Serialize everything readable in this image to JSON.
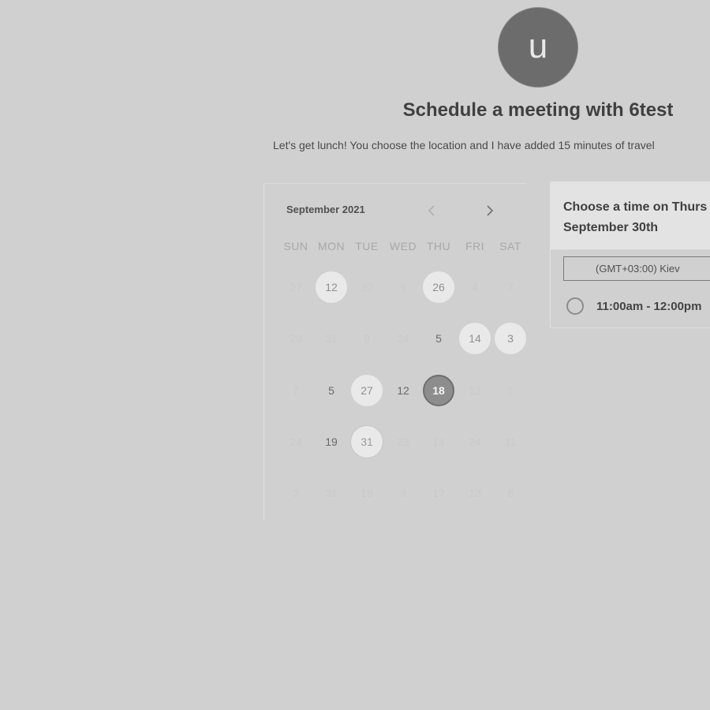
{
  "avatar": {
    "initial": "u"
  },
  "header": {
    "title": "Schedule a meeting with 6test",
    "description": "Let's get lunch! You choose the location and I have added 15 minutes of travel"
  },
  "calendar": {
    "month_label": "September 2021",
    "prev_icon": "chevron-left-icon",
    "next_icon": "chevron-right-icon",
    "weekdays": [
      "SUN",
      "MON",
      "TUE",
      "WED",
      "THU",
      "FRI",
      "SAT"
    ],
    "weeks": [
      [
        {
          "label": "27",
          "state": "faded"
        },
        {
          "label": "12",
          "state": "highlighted"
        },
        {
          "label": "30",
          "state": "faded"
        },
        {
          "label": "9",
          "state": "faded"
        },
        {
          "label": "26",
          "state": "highlighted"
        },
        {
          "label": "4",
          "state": "faded"
        },
        {
          "label": "7",
          "state": "faded"
        }
      ],
      [
        {
          "label": "20",
          "state": "faded"
        },
        {
          "label": "31",
          "state": "faded"
        },
        {
          "label": "9",
          "state": "faded"
        },
        {
          "label": "24",
          "state": "faded"
        },
        {
          "label": "5",
          "state": "available"
        },
        {
          "label": "14",
          "state": "highlighted"
        },
        {
          "label": "3",
          "state": "highlighted"
        }
      ],
      [
        {
          "label": "7",
          "state": "faded"
        },
        {
          "label": "5",
          "state": "available"
        },
        {
          "label": "27",
          "state": "highlighted"
        },
        {
          "label": "12",
          "state": "available"
        },
        {
          "label": "18",
          "state": "selected"
        },
        {
          "label": "13",
          "state": "faded"
        },
        {
          "label": "1",
          "state": "faded"
        }
      ],
      [
        {
          "label": "24",
          "state": "faded"
        },
        {
          "label": "19",
          "state": "available"
        },
        {
          "label": "31",
          "state": "noisy"
        },
        {
          "label": "23",
          "state": "faded"
        },
        {
          "label": "14",
          "state": "faded"
        },
        {
          "label": "24",
          "state": "faded"
        },
        {
          "label": "11",
          "state": "faded"
        }
      ],
      [
        {
          "label": "3",
          "state": "faded"
        },
        {
          "label": "31",
          "state": "faded"
        },
        {
          "label": "18",
          "state": "faded"
        },
        {
          "label": "9",
          "state": "faded"
        },
        {
          "label": "17",
          "state": "faded"
        },
        {
          "label": "13",
          "state": "faded"
        },
        {
          "label": "8",
          "state": "faded"
        }
      ]
    ]
  },
  "time_panel": {
    "heading_line1": "Choose a time on Thurs",
    "heading_line2": "September 30th",
    "timezone": "(GMT+03:00) Kiev",
    "slots": [
      {
        "label": "11:00am - 12:00pm"
      }
    ]
  },
  "colors": {
    "background": "#d0d0d0",
    "avatar": "#6c6c6c",
    "selected_day": "#8d8d8d",
    "highlight_day": "#e9e9e9"
  }
}
